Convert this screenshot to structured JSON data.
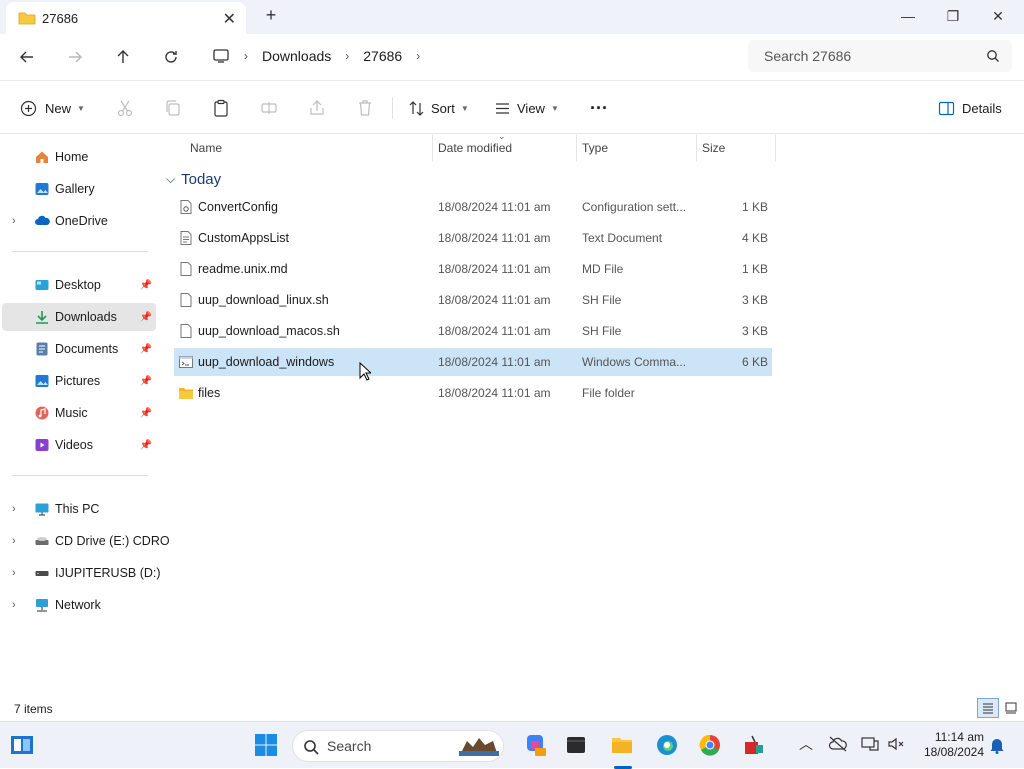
{
  "window": {
    "tab_title": "27686",
    "tab_close": "✕",
    "new_tab": "+",
    "minimize": "—",
    "maximize": "❐",
    "close": "✕"
  },
  "address": {
    "crumbs": [
      "Downloads",
      "27686"
    ],
    "search_placeholder": "Search 27686"
  },
  "commands": {
    "new_label": "New",
    "sort_label": "Sort",
    "view_label": "View",
    "more_label": "···",
    "details_label": "Details"
  },
  "sidebar": {
    "quick": [
      {
        "label": "Home",
        "icon": "home-icon"
      },
      {
        "label": "Gallery",
        "icon": "gallery-icon"
      },
      {
        "label": "OneDrive",
        "icon": "onedrive-icon"
      }
    ],
    "pinned": [
      {
        "label": "Desktop",
        "icon": "desktop-icon"
      },
      {
        "label": "Downloads",
        "icon": "downloads-icon"
      },
      {
        "label": "Documents",
        "icon": "documents-icon"
      },
      {
        "label": "Pictures",
        "icon": "pictures-icon"
      },
      {
        "label": "Music",
        "icon": "music-icon"
      },
      {
        "label": "Videos",
        "icon": "videos-icon"
      }
    ],
    "devices": [
      {
        "label": "This PC",
        "icon": "pc-icon"
      },
      {
        "label": "CD Drive (E:) CDRO",
        "icon": "cd-drive-icon"
      },
      {
        "label": "IJUPITERUSB (D:)",
        "icon": "usb-drive-icon"
      },
      {
        "label": "Network",
        "icon": "network-icon"
      }
    ],
    "selected": "Downloads"
  },
  "columns": {
    "name": "Name",
    "date": "Date modified",
    "type": "Type",
    "size": "Size"
  },
  "group_label": "Today",
  "files": [
    {
      "name": "ConvertConfig",
      "date": "18/08/2024 11:01 am",
      "type": "Configuration sett...",
      "size": "1 KB",
      "icon": "config-file-icon"
    },
    {
      "name": "CustomAppsList",
      "date": "18/08/2024 11:01 am",
      "type": "Text Document",
      "size": "4 KB",
      "icon": "text-file-icon"
    },
    {
      "name": "readme.unix.md",
      "date": "18/08/2024 11:01 am",
      "type": "MD File",
      "size": "1 KB",
      "icon": "file-icon"
    },
    {
      "name": "uup_download_linux.sh",
      "date": "18/08/2024 11:01 am",
      "type": "SH File",
      "size": "3 KB",
      "icon": "file-icon"
    },
    {
      "name": "uup_download_macos.sh",
      "date": "18/08/2024 11:01 am",
      "type": "SH File",
      "size": "3 KB",
      "icon": "file-icon"
    },
    {
      "name": "uup_download_windows",
      "date": "18/08/2024 11:01 am",
      "type": "Windows Comma...",
      "size": "6 KB",
      "icon": "cmd-script-icon"
    },
    {
      "name": "files",
      "date": "18/08/2024 11:01 am",
      "type": "File folder",
      "size": "",
      "icon": "folder-icon"
    }
  ],
  "selected_file": "uup_download_windows",
  "status": {
    "item_count": "7 items"
  },
  "taskbar": {
    "search_label": "Search",
    "time": "11:14 am",
    "date": "18/08/2024"
  },
  "colors": {
    "accent": "#0067c0",
    "selection": "#cce4f7",
    "folder": "#f8c93e",
    "titlebar": "#eff3f9"
  }
}
